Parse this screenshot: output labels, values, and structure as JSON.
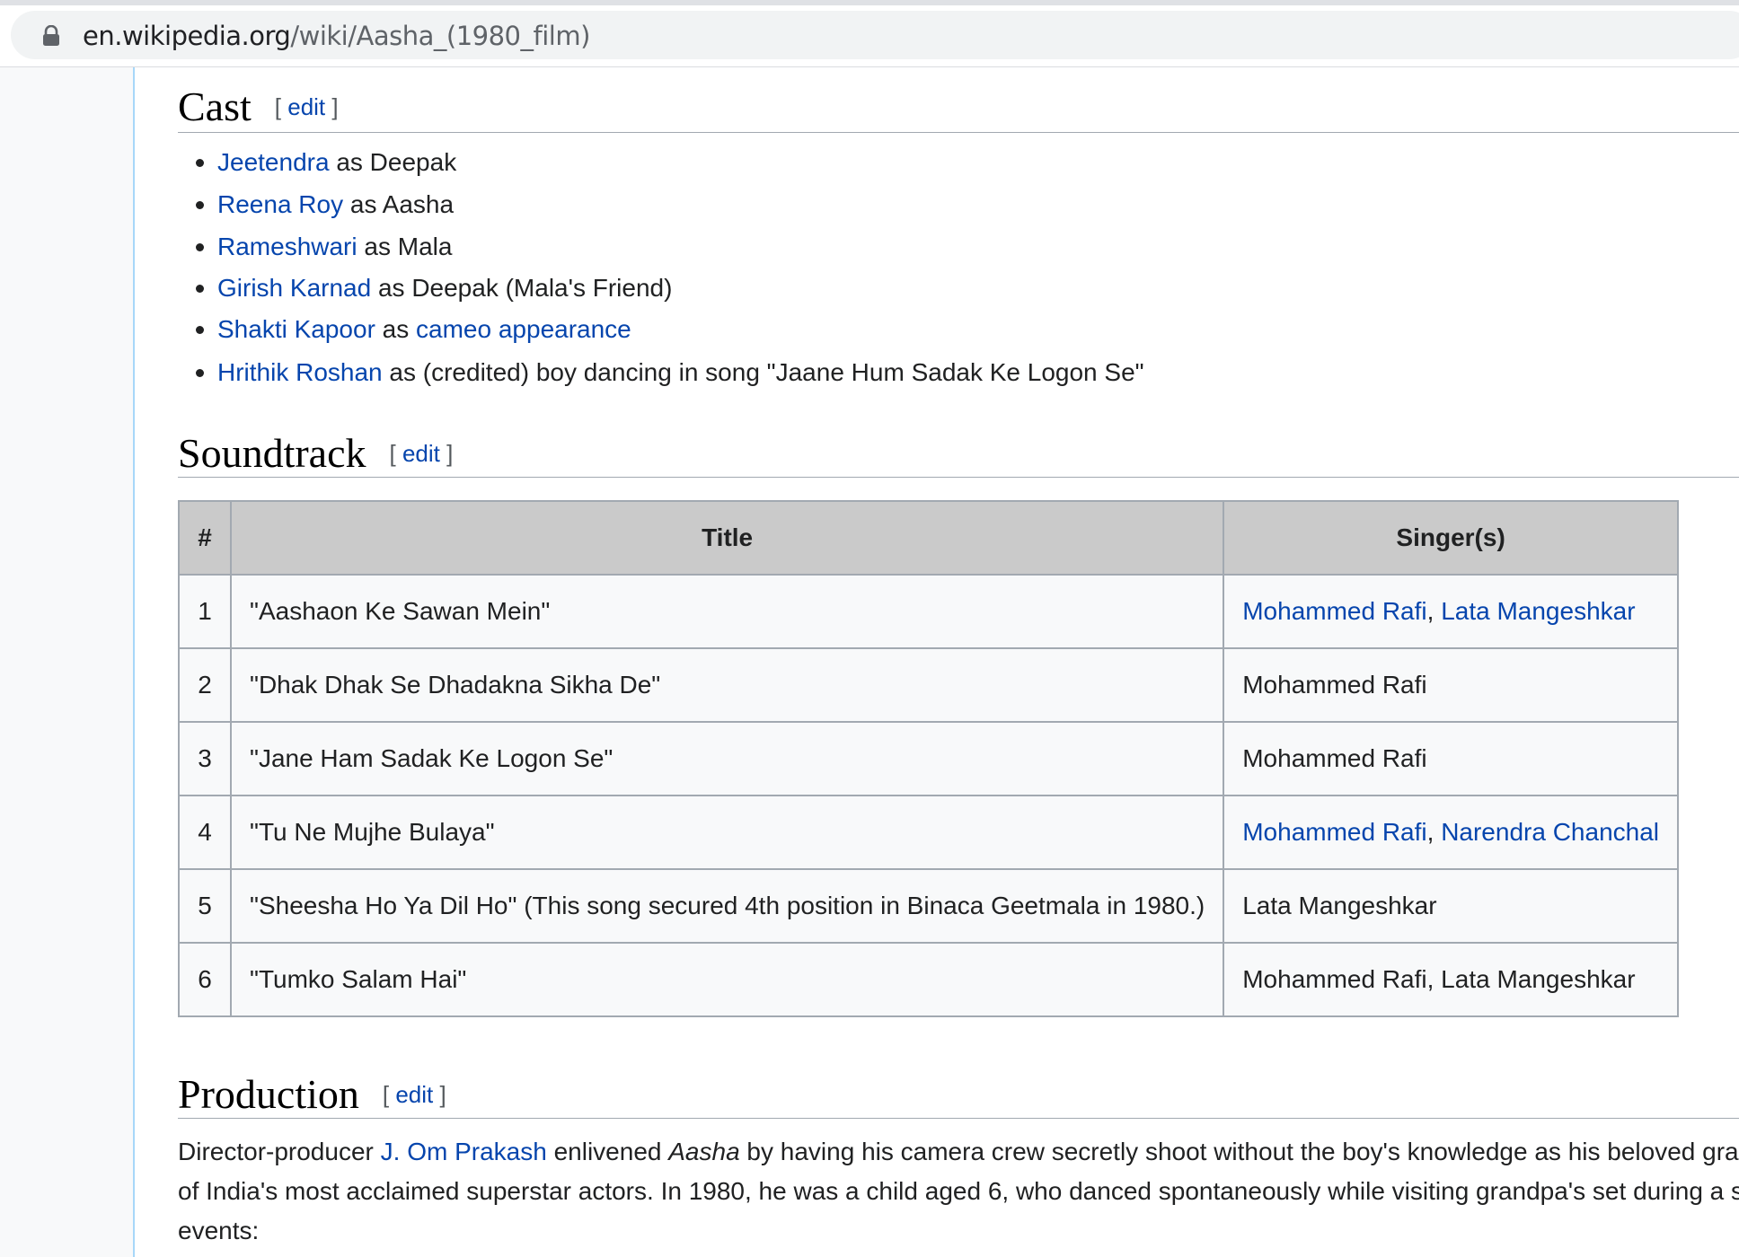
{
  "browser": {
    "url_host": "en.wikipedia.org",
    "url_path": "/wiki/Aasha_(1980_film)"
  },
  "edit_label": "edit",
  "cast": {
    "heading": "Cast",
    "items": [
      {
        "link": "Jeetendra",
        "text": " as Deepak"
      },
      {
        "link": "Reena Roy",
        "text": " as Aasha"
      },
      {
        "link": "Rameshwari",
        "text": " as Mala"
      },
      {
        "link": "Girish Karnad",
        "text": " as Deepak (Mala's Friend)"
      },
      {
        "link": "Shakti Kapoor",
        "text": " as ",
        "link2": "cameo appearance"
      },
      {
        "link": "Hrithik Roshan",
        "text": " as (credited) boy dancing in song \"Jaane Hum Sadak Ke Logon Se\""
      }
    ]
  },
  "soundtrack": {
    "heading": "Soundtrack",
    "columns": [
      "#",
      "Title",
      "Singer(s)"
    ],
    "rows": [
      {
        "num": "1",
        "title": "\"Aashaon Ke Sawan Mein\"",
        "singer_a": "Mohammed Rafi",
        "sep": ", ",
        "singer_b": "Lata Mangeshkar",
        "linked": true
      },
      {
        "num": "2",
        "title": "\"Dhak Dhak Se Dhadakna Sikha De\"",
        "singer": "Mohammed Rafi",
        "linked": false
      },
      {
        "num": "3",
        "title": "\"Jane Ham Sadak Ke Logon Se\"",
        "singer": "Mohammed Rafi",
        "linked": false
      },
      {
        "num": "4",
        "title": "\"Tu Ne Mujhe Bulaya\"",
        "singer_a": "Mohammed Rafi",
        "sep": ", ",
        "singer_b": "Narendra Chanchal",
        "linked": true
      },
      {
        "num": "5",
        "title": "\"Sheesha Ho Ya Dil Ho\" (This song secured 4th position in Binaca Geetmala in 1980.)",
        "singer": "Lata Mangeshkar",
        "linked": false
      },
      {
        "num": "6",
        "title": "\"Tumko Salam Hai\"",
        "singer": "Mohammed Rafi, Lata Mangeshkar",
        "linked": false
      }
    ]
  },
  "production": {
    "heading": "Production",
    "p1_a": "Director-producer ",
    "p1_link": "J. Om Prakash",
    "p1_b": " enlivened ",
    "p1_italic": "Aasha",
    "p1_c": " by having his camera crew secretly shoot without the boy's knowledge as his beloved gra",
    "p2": "of India's most acclaimed superstar actors. In 1980, he was a child aged 6, who danced spontaneously while visiting grandpa's set during a s",
    "p3": "events:"
  }
}
